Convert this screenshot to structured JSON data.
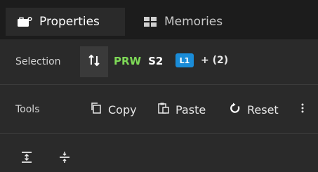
{
  "tabs": [
    {
      "label": "Properties",
      "icon": "properties-icon",
      "active": true
    },
    {
      "label": "Memories",
      "icon": "memories-grid-icon",
      "active": false
    }
  ],
  "selection": {
    "label": "Selection",
    "toggle_icon": "swap-vertical-icon",
    "primary_tag": "PRW",
    "secondary_tag": "S2",
    "badge": "L1",
    "extra": "+ (2)"
  },
  "tools": {
    "label": "Tools",
    "copy": "Copy",
    "paste": "Paste",
    "reset": "Reset",
    "more_icon": "kebab-menu-icon"
  },
  "bottom_icons": [
    "expand-icon",
    "divide-icon"
  ],
  "colors": {
    "accent_green": "#7ed957",
    "badge_blue": "#1a8cd8",
    "background": "#2a2a2a",
    "tab_bar": "#1c1c1c"
  }
}
